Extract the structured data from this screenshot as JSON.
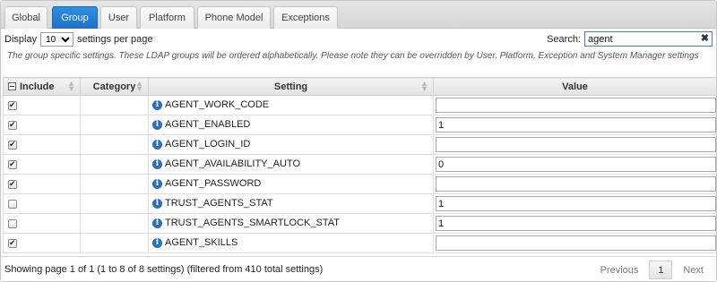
{
  "tabs": [
    {
      "label": "Global",
      "active": false
    },
    {
      "label": "Group",
      "active": true
    },
    {
      "label": "User",
      "active": false
    },
    {
      "label": "Platform",
      "active": false
    },
    {
      "label": "Phone Model",
      "active": false
    },
    {
      "label": "Exceptions",
      "active": false
    }
  ],
  "display": {
    "prefix": "Display",
    "value": "10",
    "suffix": "settings per page"
  },
  "search": {
    "label": "Search:",
    "value": "agent",
    "clear": "✖"
  },
  "description": "The group specific settings. These LDAP groups will be ordered alphabetically. Please note they can be overridden by User, Platform, Exception and System Manager settings",
  "table": {
    "headers": {
      "include": "Include",
      "category": "Category",
      "setting": "Setting",
      "value": "Value"
    },
    "rows": [
      {
        "include": true,
        "category": "",
        "setting": "AGENT_WORK_CODE",
        "value": ""
      },
      {
        "include": true,
        "category": "",
        "setting": "AGENT_ENABLED",
        "value": "1"
      },
      {
        "include": true,
        "category": "",
        "setting": "AGENT_LOGIN_ID",
        "value": ""
      },
      {
        "include": true,
        "category": "",
        "setting": "AGENT_AVAILABILITY_AUTO",
        "value": "0"
      },
      {
        "include": true,
        "category": "",
        "setting": "AGENT_PASSWORD",
        "value": ""
      },
      {
        "include": false,
        "category": "",
        "setting": "TRUST_AGENTS_STAT",
        "value": "1"
      },
      {
        "include": false,
        "category": "",
        "setting": "TRUST_AGENTS_SMARTLOCK_STAT",
        "value": "1"
      },
      {
        "include": true,
        "category": "",
        "setting": "AGENT_SKILLS",
        "value": ""
      }
    ]
  },
  "footer": {
    "info": "Showing page 1 of 1 (1 to 8 of 8 settings) (filtered from 410 total settings)",
    "previous": "Previous",
    "current_page": "1",
    "next": "Next"
  }
}
